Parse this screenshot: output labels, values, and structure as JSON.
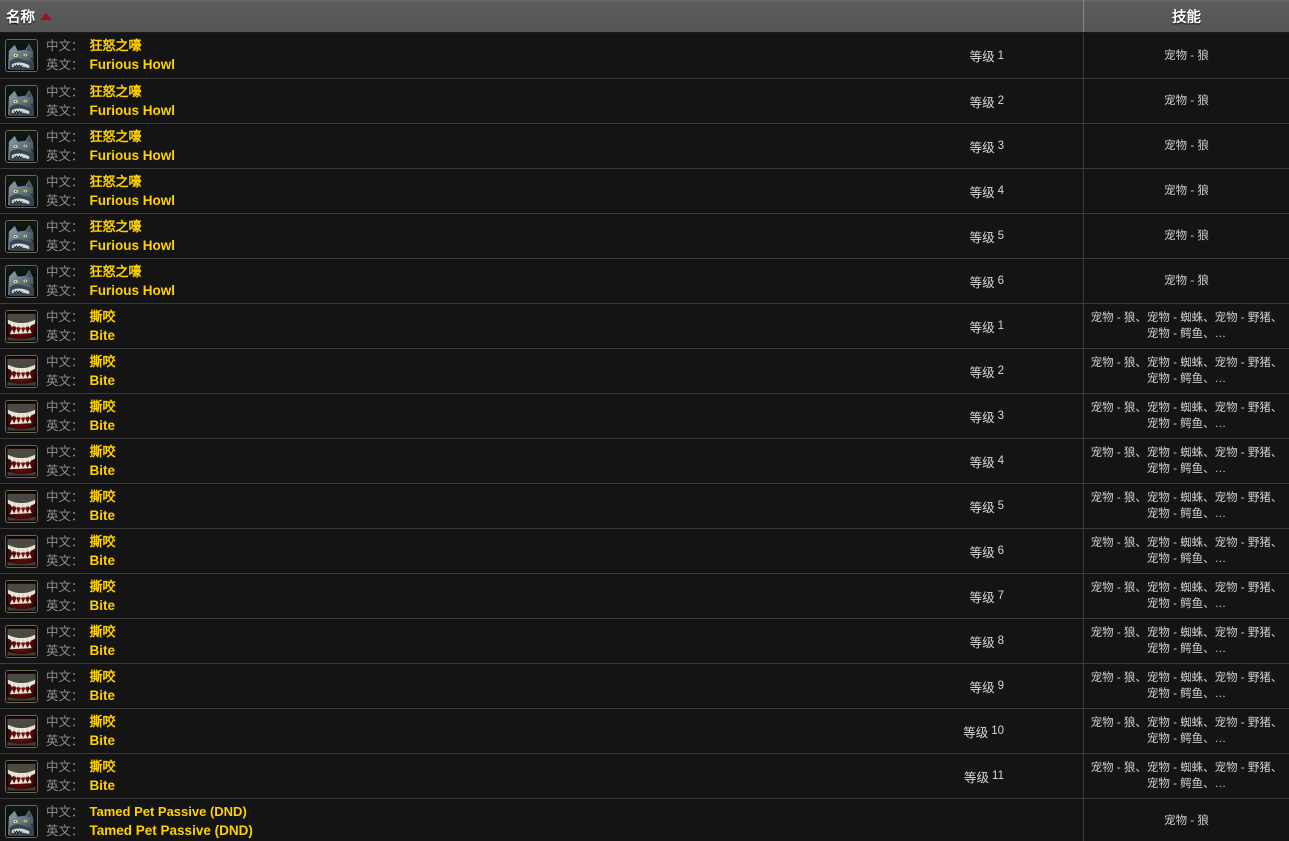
{
  "header": {
    "name_column": "名称",
    "skill_column": "技能",
    "sort_indicator": "sort-ascending-icon",
    "accent_sort_color": "#9e1020"
  },
  "labels": {
    "chinese": "中文：",
    "english": "英文：",
    "level_prefix": "等级"
  },
  "colors": {
    "value_gold": "#ffd100",
    "label_gray": "#8f8f8f",
    "row_bg": "#141414",
    "header_bg": "#575757"
  },
  "rows": [
    {
      "icon": "wolf-head-icon",
      "cn": "狂怒之嚎",
      "en": "Furious Howl",
      "level": "1",
      "skill": "宠物 - 狼"
    },
    {
      "icon": "wolf-head-icon",
      "cn": "狂怒之嚎",
      "en": "Furious Howl",
      "level": "2",
      "skill": "宠物 - 狼"
    },
    {
      "icon": "wolf-head-icon",
      "cn": "狂怒之嚎",
      "en": "Furious Howl",
      "level": "3",
      "skill": "宠物 - 狼"
    },
    {
      "icon": "wolf-head-icon",
      "cn": "狂怒之嚎",
      "en": "Furious Howl",
      "level": "4",
      "skill": "宠物 - 狼"
    },
    {
      "icon": "wolf-head-icon",
      "cn": "狂怒之嚎",
      "en": "Furious Howl",
      "level": "5",
      "skill": "宠物 - 狼"
    },
    {
      "icon": "wolf-head-icon",
      "cn": "狂怒之嚎",
      "en": "Furious Howl",
      "level": "6",
      "skill": "宠物 - 狼"
    },
    {
      "icon": "bite-teeth-icon",
      "cn": "撕咬",
      "en": "Bite",
      "level": "1",
      "skill": "宠物 - 狼、宠物 - 蜘蛛、宠物 - 野猪、宠物 - 鳄鱼、…"
    },
    {
      "icon": "bite-teeth-icon",
      "cn": "撕咬",
      "en": "Bite",
      "level": "2",
      "skill": "宠物 - 狼、宠物 - 蜘蛛、宠物 - 野猪、宠物 - 鳄鱼、…"
    },
    {
      "icon": "bite-teeth-icon",
      "cn": "撕咬",
      "en": "Bite",
      "level": "3",
      "skill": "宠物 - 狼、宠物 - 蜘蛛、宠物 - 野猪、宠物 - 鳄鱼、…"
    },
    {
      "icon": "bite-teeth-icon",
      "cn": "撕咬",
      "en": "Bite",
      "level": "4",
      "skill": "宠物 - 狼、宠物 - 蜘蛛、宠物 - 野猪、宠物 - 鳄鱼、…"
    },
    {
      "icon": "bite-teeth-icon",
      "cn": "撕咬",
      "en": "Bite",
      "level": "5",
      "skill": "宠物 - 狼、宠物 - 蜘蛛、宠物 - 野猪、宠物 - 鳄鱼、…"
    },
    {
      "icon": "bite-teeth-icon",
      "cn": "撕咬",
      "en": "Bite",
      "level": "6",
      "skill": "宠物 - 狼、宠物 - 蜘蛛、宠物 - 野猪、宠物 - 鳄鱼、…"
    },
    {
      "icon": "bite-teeth-icon",
      "cn": "撕咬",
      "en": "Bite",
      "level": "7",
      "skill": "宠物 - 狼、宠物 - 蜘蛛、宠物 - 野猪、宠物 - 鳄鱼、…"
    },
    {
      "icon": "bite-teeth-icon",
      "cn": "撕咬",
      "en": "Bite",
      "level": "8",
      "skill": "宠物 - 狼、宠物 - 蜘蛛、宠物 - 野猪、宠物 - 鳄鱼、…"
    },
    {
      "icon": "bite-teeth-icon",
      "cn": "撕咬",
      "en": "Bite",
      "level": "9",
      "skill": "宠物 - 狼、宠物 - 蜘蛛、宠物 - 野猪、宠物 - 鳄鱼、…"
    },
    {
      "icon": "bite-teeth-icon",
      "cn": "撕咬",
      "en": "Bite",
      "level": "10",
      "skill": "宠物 - 狼、宠物 - 蜘蛛、宠物 - 野猪、宠物 - 鳄鱼、…"
    },
    {
      "icon": "bite-teeth-icon",
      "cn": "撕咬",
      "en": "Bite",
      "level": "11",
      "skill": "宠物 - 狼、宠物 - 蜘蛛、宠物 - 野猪、宠物 - 鳄鱼、…"
    },
    {
      "icon": "wolf-head-icon",
      "cn": "Tamed Pet Passive (DND)",
      "en": "Tamed Pet Passive (DND)",
      "level": "",
      "skill": "宠物 - 狼"
    }
  ]
}
